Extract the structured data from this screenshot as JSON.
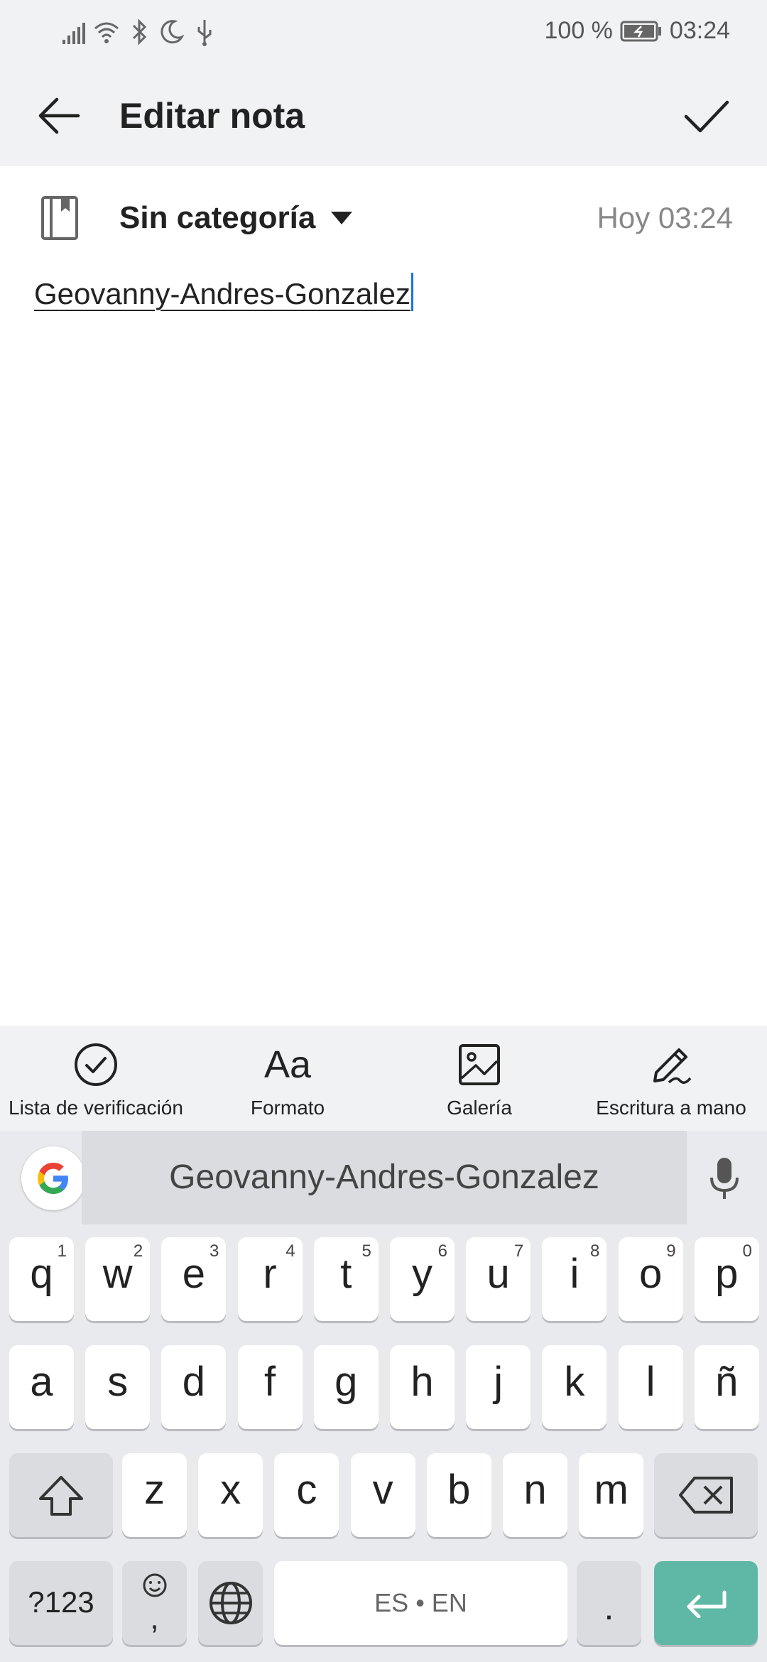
{
  "status_bar": {
    "battery": "100 %",
    "time": "03:24"
  },
  "app_bar": {
    "title": "Editar nota"
  },
  "category": {
    "label": "Sin categoría",
    "timestamp": "Hoy 03:24"
  },
  "note": {
    "text": "Geovanny-Andres-Gonzalez"
  },
  "toolbar": {
    "items": [
      {
        "label": "Lista de verificación",
        "icon": "checklist-icon"
      },
      {
        "label": "Formato",
        "icon": "format-icon",
        "glyph": "Aa"
      },
      {
        "label": "Galería",
        "icon": "gallery-icon"
      },
      {
        "label": "Escritura a mano",
        "icon": "handwriting-icon"
      }
    ]
  },
  "keyboard": {
    "suggestion": "Geovanny-Andres-Gonzalez",
    "row1": [
      {
        "k": "q",
        "h": "1"
      },
      {
        "k": "w",
        "h": "2"
      },
      {
        "k": "e",
        "h": "3"
      },
      {
        "k": "r",
        "h": "4"
      },
      {
        "k": "t",
        "h": "5"
      },
      {
        "k": "y",
        "h": "6"
      },
      {
        "k": "u",
        "h": "7"
      },
      {
        "k": "i",
        "h": "8"
      },
      {
        "k": "o",
        "h": "9"
      },
      {
        "k": "p",
        "h": "0"
      }
    ],
    "row2": [
      "a",
      "s",
      "d",
      "f",
      "g",
      "h",
      "j",
      "k",
      "l",
      "ñ"
    ],
    "row3": [
      "z",
      "x",
      "c",
      "v",
      "b",
      "n",
      "m"
    ],
    "symbols_key": "?123",
    "emoji_comma": ",",
    "space_label": "ES • EN",
    "period": ".",
    "accent_color": "#5fb8a6"
  }
}
